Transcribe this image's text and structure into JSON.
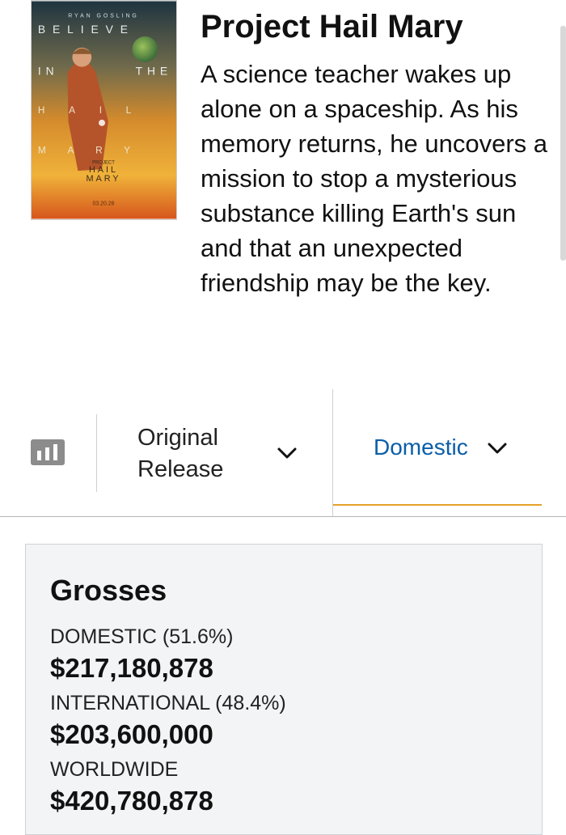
{
  "poster": {
    "top_text": "RYAN GOSLING",
    "tagline_words": [
      "BELIEVE",
      "IN",
      "THE",
      "HAIL",
      "MARY"
    ],
    "logo_top": "PROJECT",
    "logo_line1": "HAIL",
    "logo_line2": "MARY",
    "date": "03.20.26"
  },
  "movie": {
    "title": "Project Hail Mary",
    "synopsis": "A science teacher wakes up alone on a spaceship. As his memory returns, he uncovers a mission to stop a mysterious substance killing Earth's sun and that an unexpected friendship may be the key."
  },
  "selectors": {
    "release_label": "Original Release",
    "market_label": "Domestic",
    "chart_icon": "bar-chart-icon",
    "chevron_icon": "chevron-down-icon",
    "accent_color": "#e5a229",
    "link_color": "#0a5ea8"
  },
  "grosses": {
    "title": "Grosses",
    "domestic_label": "DOMESTIC (51.6%)",
    "domestic_value": "$217,180,878",
    "international_label": "INTERNATIONAL (48.4%)",
    "international_value": "$203,600,000",
    "worldwide_label": "WORLDWIDE",
    "worldwide_value": "$420,780,878"
  }
}
